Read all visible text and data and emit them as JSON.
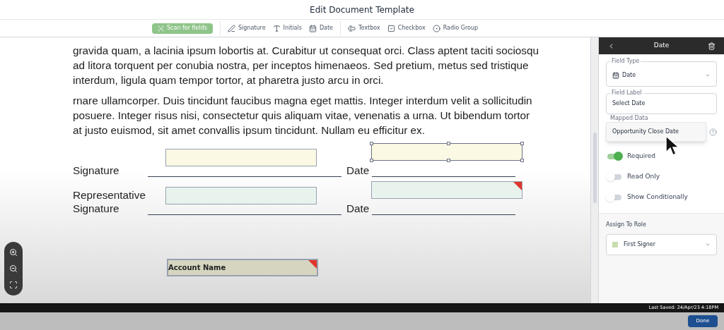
{
  "window": {
    "title": "Edit Document Template"
  },
  "toolbar": {
    "scan_button": "Scan for fields",
    "tools": [
      {
        "kind": "signature",
        "label": "Signature"
      },
      {
        "kind": "initials",
        "label": "Initials"
      },
      {
        "kind": "date",
        "label": "Date"
      },
      {
        "kind": "textbox",
        "label": "Textbox"
      },
      {
        "kind": "checkbox",
        "label": "Checkbox"
      },
      {
        "kind": "radio",
        "label": "Radio Group"
      }
    ]
  },
  "document": {
    "paragraphs": [
      "gravida quam, a lacinia ipsum lobortis at. Curabitur ut consequat orci. Class aptent taciti sociosqu ad litora torquent per conubia nostra, per inceptos himenaeos. Sed pretium, metus sed tristique interdum, ligula quam tempor tortor, at pharetra justo arcu in orci.",
      "rnare ullamcorper. Duis tincidunt faucibus magna eget mattis. Integer interdum velit a sollicitudin posuere. Integer risus nisi, consectetur quis aliquam vitae, venenatis a urna. Ut bibendum tortor at justo euismod, sit amet convallis ipsum tincidunt. Nullam eu efficitur ex."
    ],
    "signature_rows": [
      {
        "label": "Signature",
        "date_label": "Date",
        "signature_field": {
          "color": "#fbf9e4",
          "selected": false,
          "required": false
        },
        "date_field": {
          "color": "#fbf9e4",
          "selected": true,
          "required": false
        }
      },
      {
        "label": "Representative Signature",
        "date_label": "Date",
        "signature_field": {
          "color": "#e8f3ee",
          "selected": false,
          "required": false
        },
        "date_field": {
          "color": "#e8f3ee",
          "selected": false,
          "required": true
        }
      }
    ],
    "text_field": {
      "label": "Account Name",
      "required": true
    }
  },
  "panel": {
    "title": "Date",
    "field_type": {
      "label": "Field Type",
      "value": "Date"
    },
    "field_label": {
      "label": "Field Label",
      "value": "Select Date"
    },
    "mapped_data": {
      "label": "Mapped Data",
      "option": "Opportunity Close Date"
    },
    "toggles": [
      {
        "label": "Required",
        "on": true
      },
      {
        "label": "Read Only",
        "on": false
      },
      {
        "label": "Show Conditionally",
        "on": false
      }
    ],
    "role": {
      "heading": "Assign To Role",
      "value": "First Signer"
    }
  },
  "status_bar": {
    "last_saved": "Last Saved: 24/Apr/23 4:18PM"
  },
  "footer": {
    "done_button": "Done"
  }
}
